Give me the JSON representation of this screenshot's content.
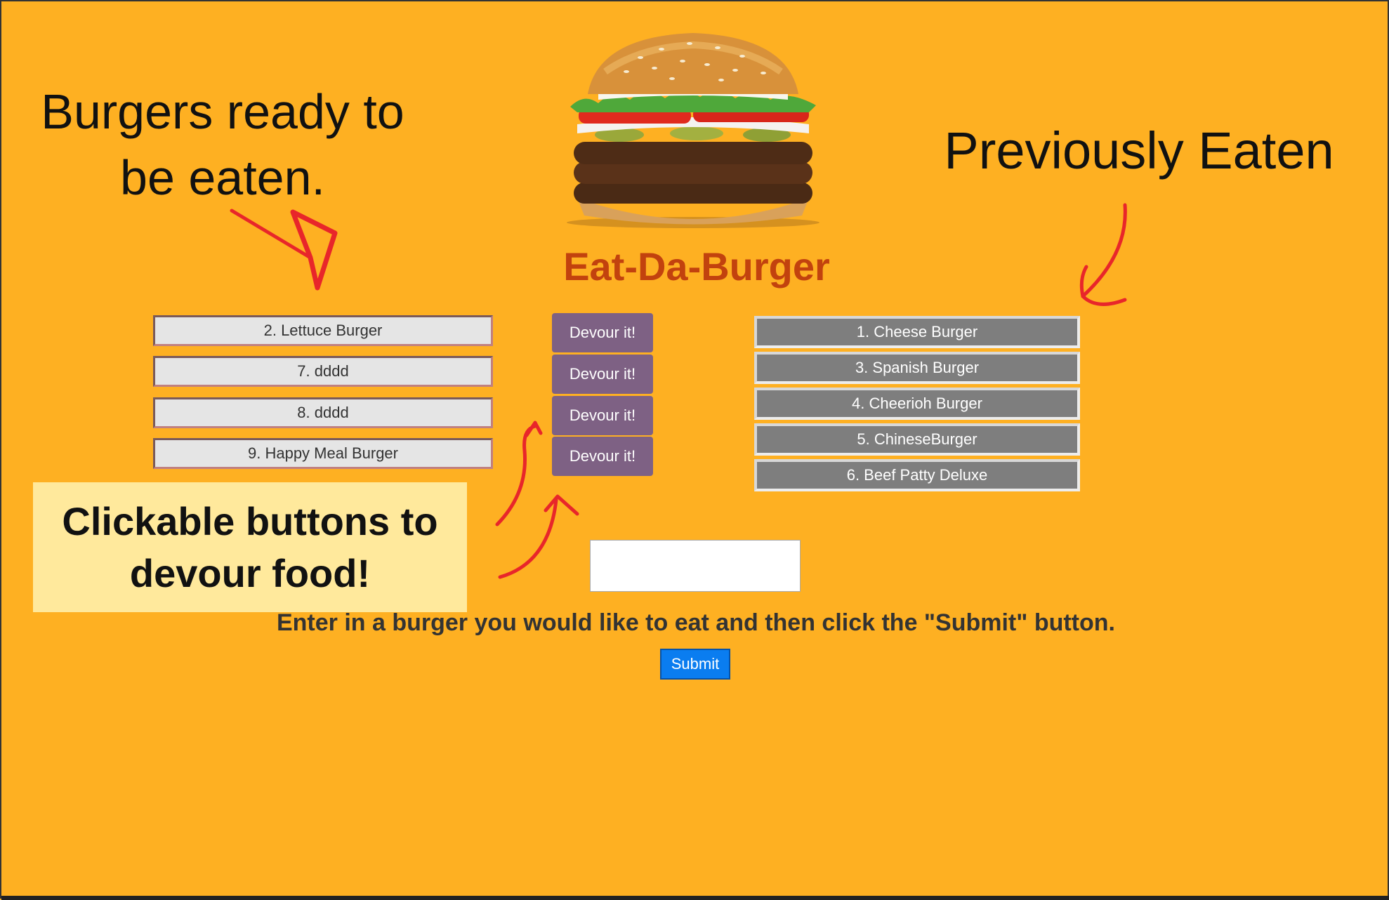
{
  "annotations": {
    "ready_note": "Burgers ready to be eaten.",
    "eaten_note": "Previously Eaten",
    "devour_note": "Clickable buttons to devour food!"
  },
  "page": {
    "title": "Eat-Da-Burger",
    "instructions": "Enter in a burger you would like to eat and then click the \"Submit\" button.",
    "submit_label": "Submit"
  },
  "ready_burgers": [
    {
      "name": "2. Lettuce Burger",
      "button": "Devour it!"
    },
    {
      "name": "7. dddd",
      "button": "Devour it!"
    },
    {
      "name": "8. dddd",
      "button": "Devour it!"
    },
    {
      "name": "9. Happy Meal Burger",
      "button": "Devour it!"
    }
  ],
  "eaten_burgers": [
    "1. Cheese Burger",
    "3. Spanish Burger",
    "4. Cheerioh Burger",
    "5. ChineseBurger",
    "6. Beef Patty Deluxe"
  ],
  "input": {
    "value": "",
    "placeholder": ""
  },
  "colors": {
    "background": "#FEB022",
    "title": "#C2420E",
    "devour_button": "#7E6184",
    "eaten_item": "#7E7E7E",
    "submit_button": "#0A7DF0",
    "annotation_arrow": "#E8262A",
    "note_box": "#FFE99C"
  }
}
